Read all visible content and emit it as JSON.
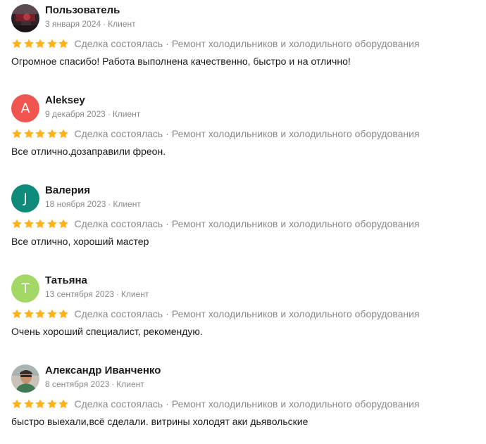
{
  "reviews": [
    {
      "name": "Пользователь",
      "date": "3 января 2024",
      "role": "Клиент",
      "avatar_type": "photo",
      "avatar_letter": "",
      "rating": 5,
      "deal_status": "Сделка состоялась",
      "category": "Ремонт холодильников и холодильного оборудования",
      "text": "Огромное спасибо! Работа выполнена качественно, быстро и на отлично!"
    },
    {
      "name": "Aleksey",
      "date": "9 декабря 2023",
      "role": "Клиент",
      "avatar_type": "letter",
      "avatar_letter": "A",
      "avatar_color": "#f0564f",
      "rating": 5,
      "deal_status": "Сделка состоялась",
      "category": "Ремонт холодильников и холодильного оборудования",
      "text": "Все отлично.дозаправили фреон."
    },
    {
      "name": "Валерия",
      "date": "18 ноября 2023",
      "role": "Клиент",
      "avatar_type": "letter",
      "avatar_letter": "J",
      "avatar_color": "#0e8a7a",
      "rating": 5,
      "deal_status": "Сделка состоялась",
      "category": "Ремонт холодильников и холодильного оборудования",
      "text": "Все отлично, хороший мастер"
    },
    {
      "name": "Татьяна",
      "date": "13 сентября 2023",
      "role": "Клиент",
      "avatar_type": "letter",
      "avatar_letter": "T",
      "avatar_color": "#a3d866",
      "rating": 5,
      "deal_status": "Сделка состоялась",
      "category": "Ремонт холодильников и холодильного оборудования",
      "text": "Очень хороший специалист, рекомендую."
    },
    {
      "name": "Александр Иванченко",
      "date": "8 сентября 2023",
      "role": "Клиент",
      "avatar_type": "photo",
      "avatar_letter": "",
      "rating": 5,
      "deal_status": "Сделка состоялась",
      "category": "Ремонт холодильников и холодильного оборудования",
      "text": "быстро выехали,всё сделали. витрины холодят аки дьявольские"
    }
  ],
  "star_color": "#ffb21e",
  "separator": "·"
}
